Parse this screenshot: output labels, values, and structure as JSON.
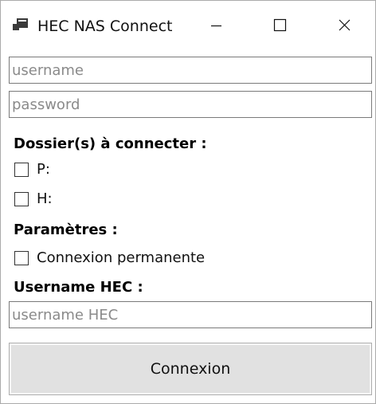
{
  "window": {
    "title": "HEC NAS Connect",
    "icon": "app-window-icon"
  },
  "title_controls": {
    "minimize_icon": "minimize-icon",
    "maximize_icon": "maximize-icon",
    "close_icon": "close-icon"
  },
  "login": {
    "username_placeholder": "username",
    "username_value": "",
    "password_placeholder": "password",
    "password_value": ""
  },
  "folders": {
    "heading": "Dossier(s) à connecter :",
    "items": [
      {
        "label": "P:",
        "checked": false
      },
      {
        "label": "H:",
        "checked": false
      }
    ]
  },
  "settings": {
    "heading": "Paramètres :",
    "permanent_label": "Connexion permanente",
    "permanent_checked": false
  },
  "hec": {
    "heading": "Username HEC :",
    "placeholder": "username HEC",
    "value": ""
  },
  "actions": {
    "connect_label": "Connexion"
  },
  "colors": {
    "accent_text": "#000000",
    "button_bg": "#e1e1e1",
    "input_border": "#7a7a7a"
  }
}
